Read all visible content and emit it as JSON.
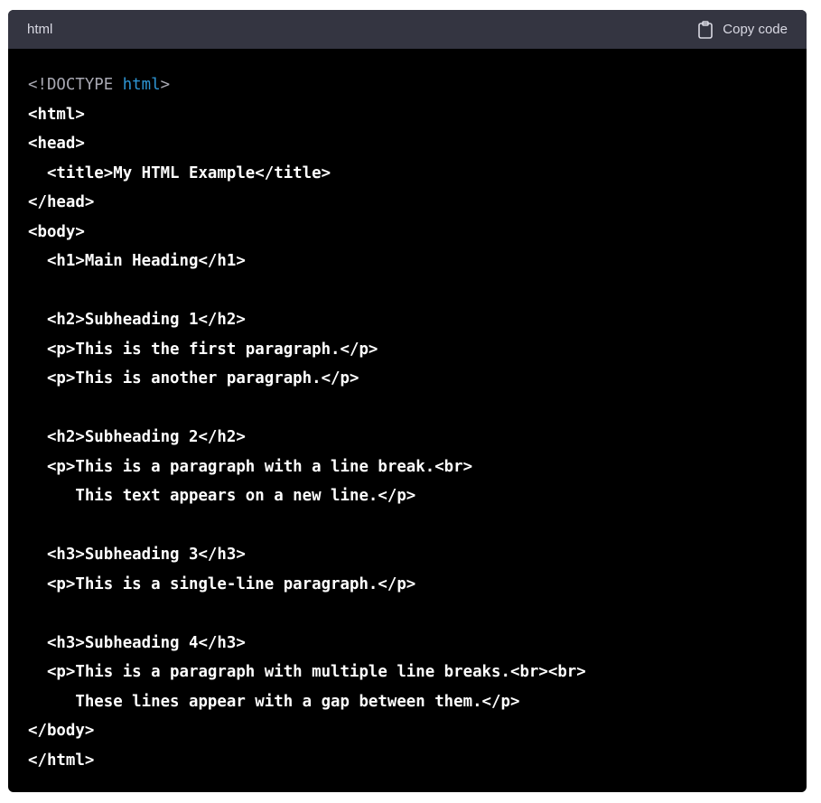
{
  "header": {
    "language": "html",
    "copy_label": "Copy code",
    "copy_icon": "clipboard-icon"
  },
  "colors": {
    "header_bg": "#343541",
    "code_bg": "#000000",
    "text": "#ffffff",
    "doctype": "#a9a9b3",
    "keyword": "#2e95d3"
  },
  "code": {
    "doctype": {
      "prefix": "<!DOCTYPE ",
      "keyword": "html",
      "suffix": ">"
    },
    "lines": [
      "<html>",
      "<head>",
      "  <title>My HTML Example</title>",
      "</head>",
      "<body>",
      "  <h1>Main Heading</h1>",
      "",
      "  <h2>Subheading 1</h2>",
      "  <p>This is the first paragraph.</p>",
      "  <p>This is another paragraph.</p>",
      "",
      "  <h2>Subheading 2</h2>",
      "  <p>This is a paragraph with a line break.<br>",
      "     This text appears on a new line.</p>",
      "",
      "  <h3>Subheading 3</h3>",
      "  <p>This is a single-line paragraph.</p>",
      "",
      "  <h3>Subheading 4</h3>",
      "  <p>This is a paragraph with multiple line breaks.<br><br>",
      "     These lines appear with a gap between them.</p>",
      "</body>",
      "</html>"
    ]
  }
}
